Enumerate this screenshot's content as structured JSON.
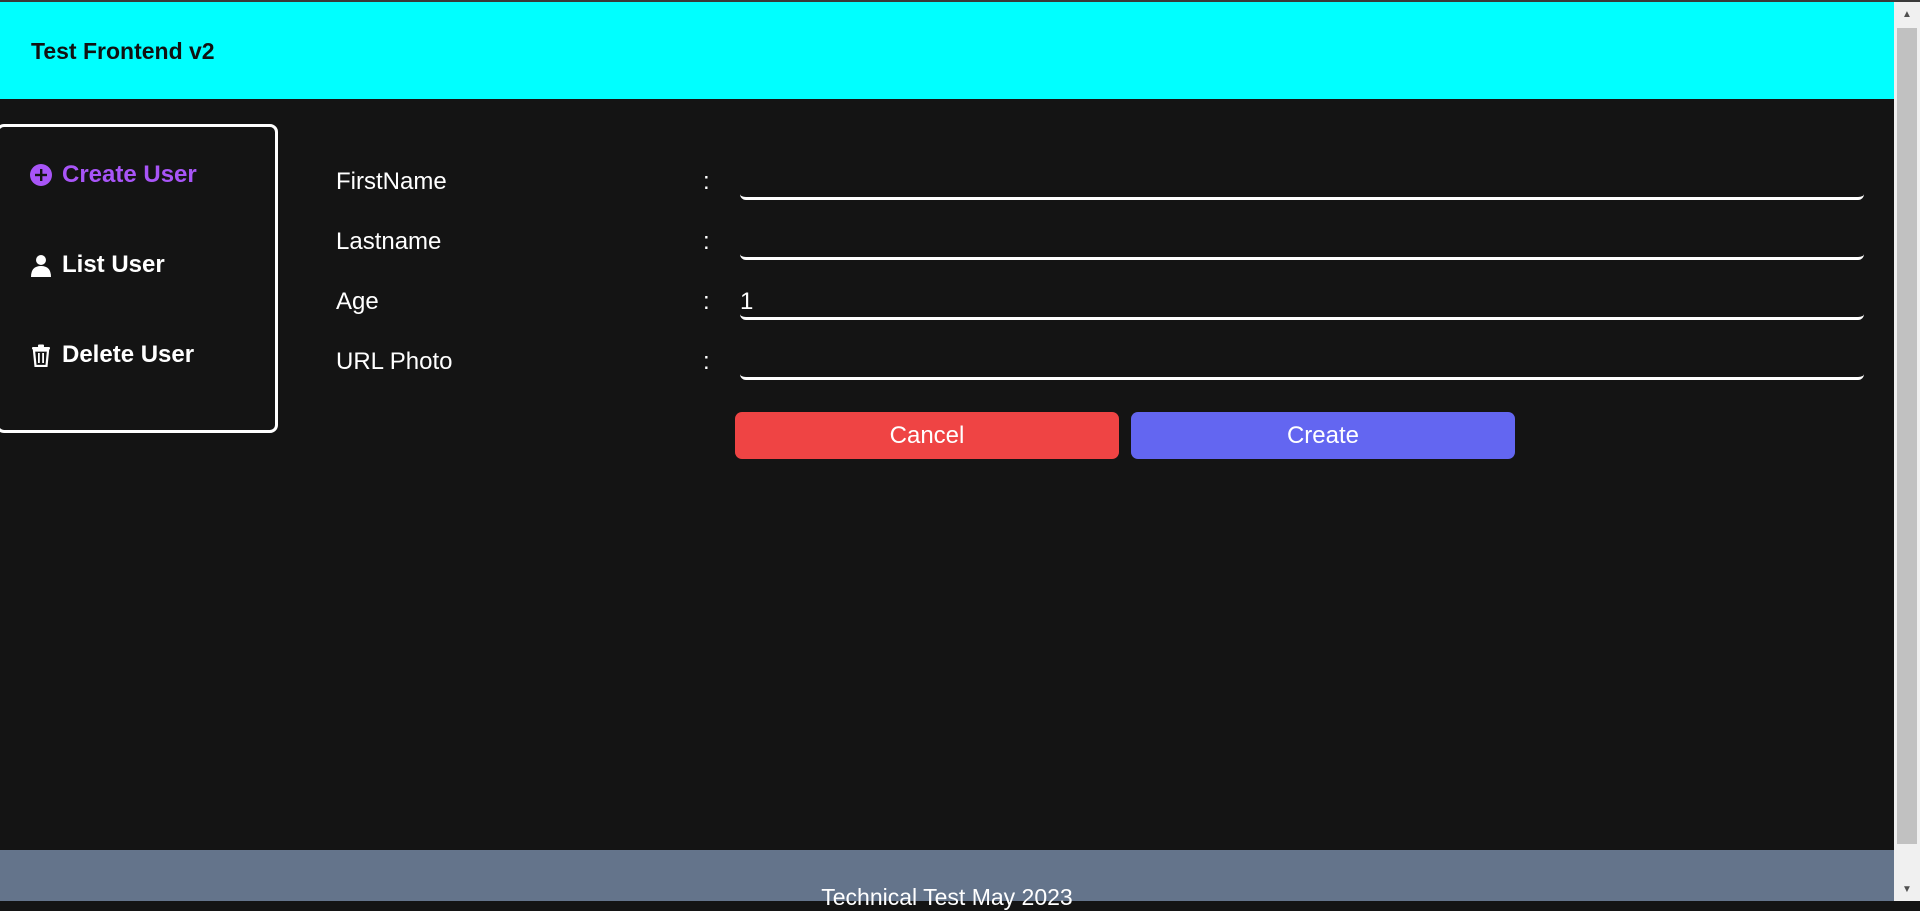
{
  "header": {
    "title": "Test Frontend v2"
  },
  "sidebar": {
    "items": [
      {
        "label": "Create User",
        "icon": "plus-circle-icon",
        "active": true
      },
      {
        "label": "List User",
        "icon": "user-icon",
        "active": false
      },
      {
        "label": "Delete User",
        "icon": "trash-icon",
        "active": false
      }
    ]
  },
  "form": {
    "separator": ":",
    "fields": [
      {
        "label": "FirstName",
        "value": ""
      },
      {
        "label": "Lastname",
        "value": ""
      },
      {
        "label": "Age",
        "value": "1"
      },
      {
        "label": "URL Photo",
        "value": ""
      }
    ],
    "cancel_label": "Cancel",
    "create_label": "Create"
  },
  "footer": {
    "text": "Technical Test May 2023"
  },
  "colors": {
    "header_bg": "#00ffff",
    "active_accent": "#a855f7",
    "cancel_button": "#ef4444",
    "create_button": "#6366f1",
    "footer_bg": "#64748b",
    "page_bg": "#141414"
  }
}
